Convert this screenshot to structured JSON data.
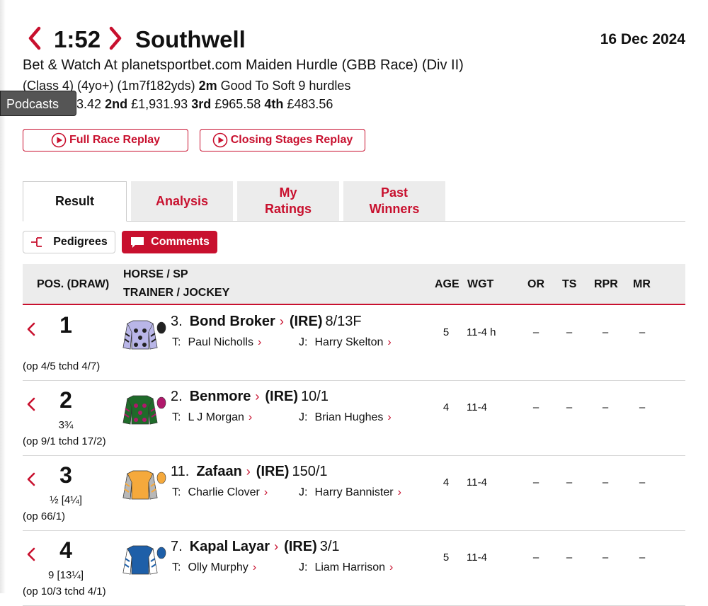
{
  "header": {
    "time": "1:52",
    "course": "Southwell",
    "date": "16 Dec 2024",
    "race_title": "Bet & Watch At planetsportbet.com Maiden Hurdle (GBB Race) (Div II)",
    "conditions_prefix": "(Class 4) (4yo+) (1m7f182yds)",
    "distance": "2m",
    "conditions_suffix": "Good To Soft 9 hurdles",
    "prize_first_partial": "3.42",
    "prize_2nd_label": "2nd",
    "prize_2nd": "£1,931.93",
    "prize_3rd_label": "3rd",
    "prize_3rd": "£965.58",
    "prize_4th_label": "4th",
    "prize_4th": "£483.56"
  },
  "podcasts_label": "Podcasts",
  "replays": {
    "full": "Full Race Replay",
    "closing": "Closing Stages Replay"
  },
  "tabs": {
    "result": "Result",
    "analysis": "Analysis",
    "my_ratings": "My Ratings",
    "past_winners": "Past Winners"
  },
  "chips": {
    "pedigrees": "Pedigrees",
    "comments": "Comments"
  },
  "columns": {
    "pos": "POS. (DRAW)",
    "horse_sp": "HORSE / SP",
    "trainer_jockey": "TRAINER / JOCKEY",
    "age": "AGE",
    "wgt": "WGT",
    "or": "OR",
    "ts": "TS",
    "rpr": "RPR",
    "mr": "MR"
  },
  "labels": {
    "trainer": "T:",
    "jockey": "J:"
  },
  "runners": [
    {
      "pos": "1",
      "dist": "",
      "odds_history": "(op 4/5 tchd 4/7)",
      "num": "3.",
      "name": "Bond Broker",
      "origin": "(IRE)",
      "sp": "8/13F",
      "trainer": "Paul Nicholls",
      "jockey": "Harry Skelton",
      "age": "5",
      "wgt": "11-4 h",
      "or": "–",
      "ts": "–",
      "rpr": "–",
      "mr": "–",
      "silk": {
        "body": "#b9b6e8",
        "sleeve": "#b9b6e8",
        "pattern": "#222222",
        "cap": "#222222"
      }
    },
    {
      "pos": "2",
      "dist": "3¾",
      "odds_history": "(op 9/1 tchd 17/2)",
      "num": "2.",
      "name": "Benmore",
      "origin": "(IRE)",
      "sp": "10/1",
      "trainer": "L J Morgan",
      "jockey": "Brian Hughes",
      "age": "4",
      "wgt": "11-4",
      "or": "–",
      "ts": "–",
      "rpr": "–",
      "mr": "–",
      "silk": {
        "body": "#1f6b2a",
        "sleeve": "#1f6b2a",
        "pattern": "#b0186b",
        "cap": "#b0186b"
      }
    },
    {
      "pos": "3",
      "dist": "½ [4¼]",
      "odds_history": "(op 66/1)",
      "num": "11.",
      "name": "Zafaan",
      "origin": "(IRE)",
      "sp": "150/1",
      "trainer": "Charlie Clover",
      "jockey": "Harry Bannister",
      "age": "4",
      "wgt": "11-4",
      "or": "–",
      "ts": "–",
      "rpr": "–",
      "mr": "–",
      "silk": {
        "body": "#f5a93c",
        "sleeve": "#b8b8b8",
        "pattern": "#f5a93c",
        "cap": "#f5a93c"
      }
    },
    {
      "pos": "4",
      "dist": "9 [13¼]",
      "odds_history": "(op 10/3 tchd 4/1)",
      "num": "7.",
      "name": "Kapal Layar",
      "origin": "(IRE)",
      "sp": "3/1",
      "trainer": "Olly Murphy",
      "jockey": "Liam Harrison",
      "age": "5",
      "wgt": "11-4",
      "or": "–",
      "ts": "–",
      "rpr": "–",
      "mr": "–",
      "silk": {
        "body": "#1e5fa8",
        "sleeve": "#ffffff",
        "pattern": "#1e5fa8",
        "cap": "#1e5fa8"
      }
    }
  ]
}
